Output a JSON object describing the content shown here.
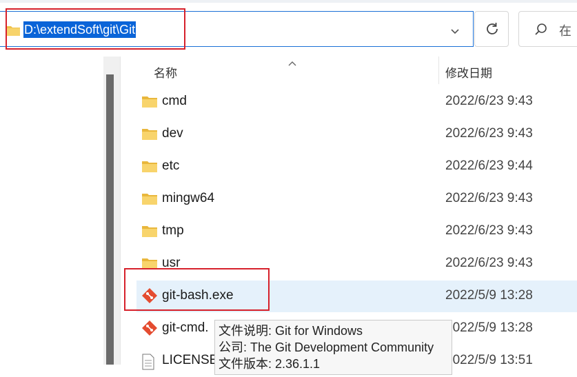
{
  "address_bar": {
    "path": "D:\\extendSoft\\git\\Git"
  },
  "search": {
    "placeholder": "在"
  },
  "columns": {
    "name": "名称",
    "date": "修改日期"
  },
  "files": [
    {
      "name": "cmd",
      "date": "2022/6/23 9:43",
      "icon": "folder-icon"
    },
    {
      "name": "dev",
      "date": "2022/6/23 9:43",
      "icon": "folder-icon"
    },
    {
      "name": "etc",
      "date": "2022/6/23 9:44",
      "icon": "folder-icon"
    },
    {
      "name": "mingw64",
      "date": "2022/6/23 9:43",
      "icon": "folder-icon"
    },
    {
      "name": "tmp",
      "date": "2022/6/23 9:43",
      "icon": "folder-icon"
    },
    {
      "name": "usr",
      "date": "2022/6/23 9:43",
      "icon": "folder-icon"
    },
    {
      "name": "git-bash.exe",
      "date": "2022/5/9 13:28",
      "icon": "git-icon"
    },
    {
      "name": "git-cmd.",
      "date": "2022/5/9 13:28",
      "icon": "git-icon"
    },
    {
      "name": "LICENSE",
      "date": "2022/5/9 13:51",
      "icon": "document-icon"
    }
  ],
  "tooltip": {
    "description": "文件说明: Git for Windows",
    "company": "公司: The Git Development Community",
    "version": "文件版本: 2.36.1.1"
  },
  "colors": {
    "selection": "#0a64d8",
    "annotation": "#d6202a",
    "row_highlight": "#e5f1fb"
  }
}
